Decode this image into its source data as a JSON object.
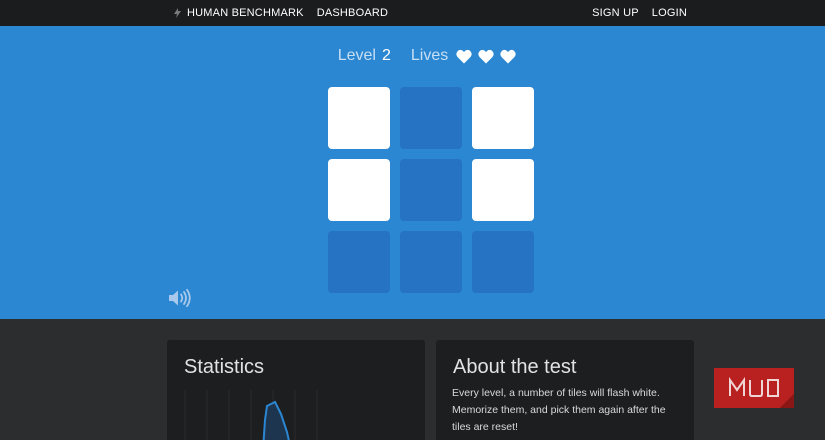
{
  "nav": {
    "brand": "HUMAN BENCHMARK",
    "dashboard": "DASHBOARD",
    "signup": "SIGN UP",
    "login": "LOGIN"
  },
  "hud": {
    "level_label": "Level",
    "level_value": "2",
    "lives_label": "Lives",
    "lives_count": 3
  },
  "grid": {
    "tiles": [
      true,
      false,
      true,
      true,
      false,
      true,
      false,
      false,
      false
    ]
  },
  "statistics": {
    "title": "Statistics"
  },
  "about": {
    "title": "About the test",
    "text": "Every level, a number of tiles will flash white. Memorize them, and pick them again after the tiles are reset!"
  },
  "logo": {
    "text": "MUO"
  },
  "colors": {
    "game_bg": "#2b87d1",
    "tile_dim": "#2573c2",
    "tile_lit": "#ffffff",
    "nav_bg": "#1b1c1d",
    "logo_red": "#b8211f"
  }
}
